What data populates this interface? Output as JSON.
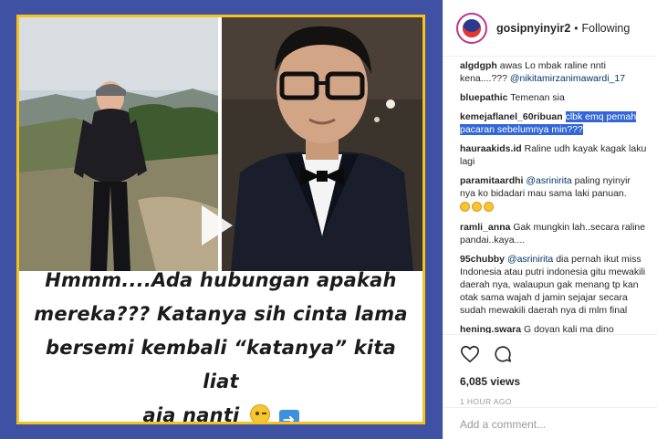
{
  "post": {
    "caption_lines": [
      "Hmmm....Ada hubungan apakah",
      "mereka??? Katanya sih cinta lama",
      "bersemi kembali “katanya” kita liat",
      "aja nanti"
    ],
    "frame_color": "#f4c21b",
    "background_color": "#3f51a3"
  },
  "header": {
    "username": "gosipnyinyir2",
    "separator": "•",
    "follow_status": "Following"
  },
  "comments": [
    {
      "user": "algdgph",
      "text": "awas Lo mbak raline nnti kena....??? ",
      "mention": "@nikitamirzanimawardi_17"
    },
    {
      "user": "bluepathic",
      "text": "Temenan sia"
    },
    {
      "user": "kemejaflanel_60ribuan",
      "highlighted": "clbk emq pernah pacaran sebelumnya min???"
    },
    {
      "user": "hauraakids.id",
      "text": "Raline udh kayak kagak laku lagi"
    },
    {
      "user": "paramitaardhi",
      "mention": "@asrinirita",
      "text": " paling nyinyir nya ko bidadari mau sama laki panuan.",
      "emoji_count": 3
    },
    {
      "user": "ramli_anna",
      "text": "Gak mungkin lah..secara raline pandai..kaya...."
    },
    {
      "user": "95chubby",
      "mention": "@asrinirita",
      "text": " dia pernah ikut miss Indonesia atau putri indonesia gitu mewakili daerah nya, walaupun gak menang tp kan otak sama wajah d jamin sejajar secara sudah mewakili daerah nya di mlm final"
    },
    {
      "user": "hening.swara",
      "text": "G doyan kali ma dino"
    }
  ],
  "actions": {
    "like_icon": "heart-icon",
    "comment_icon": "comment-bubble-icon",
    "views": "6,085 views",
    "timestamp": "1 HOUR AGO"
  },
  "add_comment": {
    "placeholder": "Add a comment..."
  }
}
